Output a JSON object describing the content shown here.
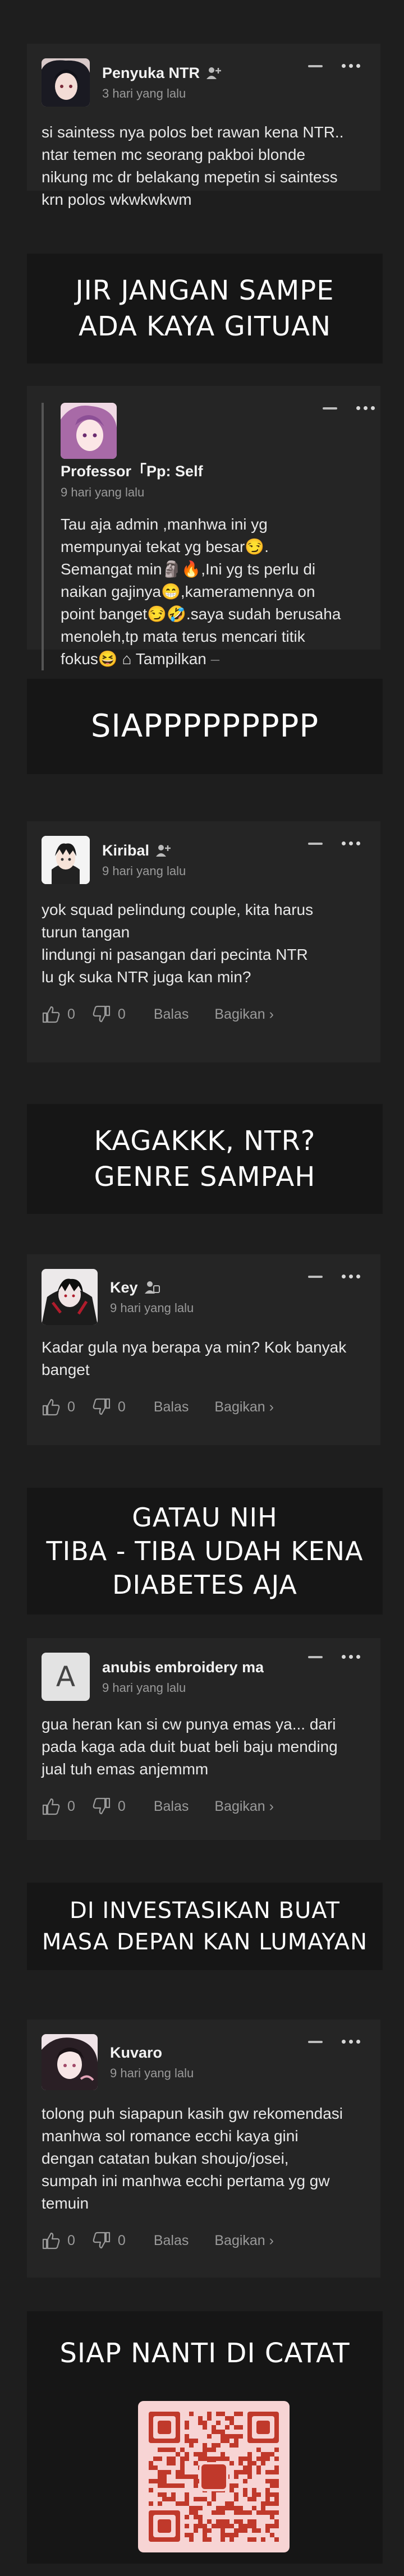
{
  "comments": [
    {
      "name": "Penyuka NTR",
      "time": "3 hari yang lalu",
      "text": "si saintess nya polos bet rawan kena NTR..\nntar temen mc seorang pakboi blonde\nnikung mc dr belakang mepetin si saintess\nkrn polos wkwkwkwm",
      "likes": "0",
      "dislikes": "0",
      "reply_label": "Balas",
      "share_label": "Bagikan ›",
      "role_icon": "person-plus-icon"
    },
    {
      "name": "Professor「Pp: Self",
      "time": "9 hari yang lalu",
      "text": "Tau aja admin ,manhwa ini yg\nmempunyai tekat yg besar😏.\nSemangat min🗿🔥,Ini yg ts perlu di\nnaikan gajinya😁,kameramennya on\npoint banget😏🤣.saya sudah berusaha\nmenoleh,tp mata terus mencari titik\nfokus😆",
      "more_label": "Tampilkan",
      "role_icon": ""
    },
    {
      "name": "Kiribal",
      "time": "9 hari yang lalu",
      "text": "yok squad pelindung couple, kita harus\nturun tangan\nlindungi ni pasangan dari pecinta NTR\nlu gk suka NTR juga kan min?",
      "likes": "0",
      "dislikes": "0",
      "reply_label": "Balas",
      "share_label": "Bagikan ›",
      "role_icon": "person-plus-icon"
    },
    {
      "name": "Key",
      "time": "9 hari yang lalu",
      "text": "Kadar gula nya berapa ya min? Kok banyak\nbanget",
      "likes": "0",
      "dislikes": "0",
      "reply_label": "Balas",
      "share_label": "Bagikan ›",
      "role_icon": "person-badge-icon"
    },
    {
      "name": "anubis embroidery ma",
      "time": "9 hari yang lalu",
      "avatar_letter": "A",
      "text": "gua heran kan si cw punya emas ya... dari\npada kaga ada duit buat beli baju mending\njual tuh emas anjemmm",
      "likes": "0",
      "dislikes": "0",
      "reply_label": "Balas",
      "share_label": "Bagikan ›"
    },
    {
      "name": "Kuvaro",
      "time": "9 hari yang lalu",
      "text": "tolong puh siapapun kasih gw rekomendasi\nmanhwa sol romance ecchi kaya gini\ndengan catatan bukan shoujo/josei,\nsumpah ini manhwa ecchi pertama yg gw\ntemuin",
      "likes": "0",
      "dislikes": "0",
      "reply_label": "Balas",
      "share_label": "Bagikan ›"
    }
  ],
  "banners": [
    "JIR JANGAN SAMPE\nADA KAYA GITUAN",
    "SIAPPPPPPPPP",
    "KAGAKKK, NTR?\nGENRE SAMPAH",
    "GATAU NIH\nTIBA - TIBA UDAH KENA\nDIABETES AJA",
    "DI INVESTASIKAN BUAT\nMASA DEPAN KAN LUMAYAN",
    "SIAP NANTI DI CATAT"
  ],
  "colors": {
    "page_bg": "#1e1e1e",
    "card_bg": "#252525",
    "banner_bg": "#161616",
    "qr_bg": "#f7d4d4",
    "qr_fg": "#c0392b"
  }
}
